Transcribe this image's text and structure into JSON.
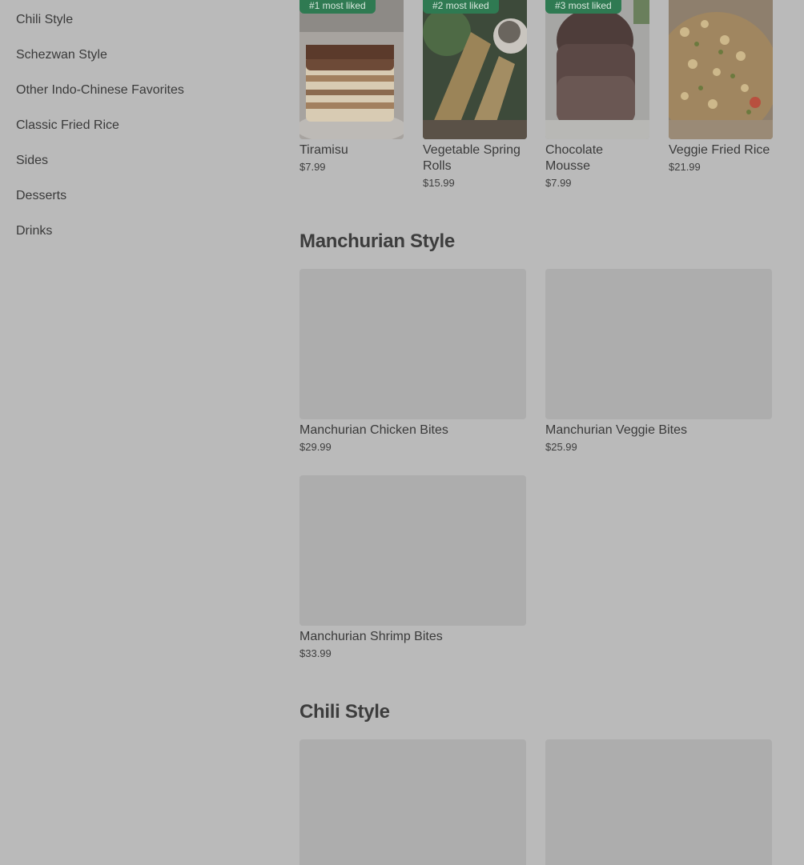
{
  "sidebar": {
    "items": [
      {
        "label": "Chili Style"
      },
      {
        "label": "Schezwan Style"
      },
      {
        "label": "Other Indo-Chinese Favorites"
      },
      {
        "label": "Classic Fried Rice"
      },
      {
        "label": "Sides"
      },
      {
        "label": "Desserts"
      },
      {
        "label": "Drinks"
      }
    ]
  },
  "most_liked": [
    {
      "badge": "#1 most liked",
      "name": "Tiramisu",
      "price": "$7.99"
    },
    {
      "badge": "#2 most liked",
      "name": "Vegetable Spring Rolls",
      "price": "$15.99"
    },
    {
      "badge": "#3 most liked",
      "name": "Chocolate Mousse",
      "price": "$7.99"
    },
    {
      "badge": "",
      "name": "Veggie Fried Rice",
      "price": "$21.99"
    }
  ],
  "sections": [
    {
      "title": "Manchurian Style",
      "items": [
        {
          "name": "Manchurian Chicken Bites",
          "price": "$29.99"
        },
        {
          "name": "Manchurian Veggie Bites",
          "price": "$25.99"
        },
        {
          "name": "Manchurian Shrimp Bites",
          "price": "$33.99"
        }
      ]
    },
    {
      "title": "Chili Style",
      "items": [
        {
          "name": "",
          "price": ""
        },
        {
          "name": "",
          "price": ""
        }
      ]
    }
  ],
  "colors": {
    "overlay": "#bababa",
    "badge_bg": "#2f7a52",
    "placeholder": "#adadad"
  }
}
